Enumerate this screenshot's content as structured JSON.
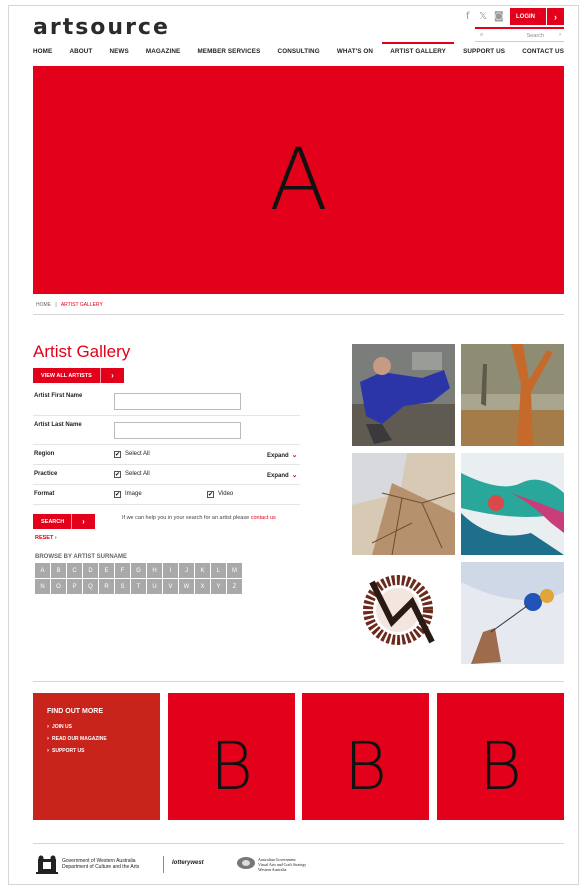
{
  "site": {
    "logo": "artsource"
  },
  "header": {
    "social": {
      "facebook": "f",
      "twitter": "𝕏",
      "instagram": "◙"
    },
    "login_label": "LOGIN",
    "search_placeholder": "Search"
  },
  "nav": [
    "HOME",
    "ABOUT",
    "NEWS",
    "MAGAZINE",
    "MEMBER SERVICES",
    "CONSULTING",
    "WHAT'S ON",
    "ARTIST GALLERY",
    "SUPPORT US",
    "CONTACT US"
  ],
  "hero": {
    "letter": "A"
  },
  "breadcrumb": {
    "home": "HOME",
    "separator": "|",
    "current": "ARTIST GALLERY"
  },
  "gallery": {
    "title": "Artist Gallery",
    "view_all_label": "VIEW ALL ARTISTS",
    "first_name_label": "Artist First Name",
    "first_name_value": "",
    "last_name_label": "Artist Last Name",
    "last_name_value": "",
    "region_label": "Region",
    "practice_label": "Practice",
    "format_label": "Format",
    "select_all": "Select All",
    "expand": "Expand",
    "image_label": "Image",
    "video_label": "Video",
    "search_label": "SEARCH",
    "help_text": "If we can help you in your search for an artist please",
    "help_link": "contact us",
    "reset_label": "RESET",
    "browse_label": "BROWSE BY ARTIST SURNAME",
    "letters": [
      "A",
      "B",
      "C",
      "D",
      "E",
      "F",
      "G",
      "H",
      "I",
      "J",
      "K",
      "L",
      "M",
      "N",
      "O",
      "P",
      "Q",
      "R",
      "S",
      "T",
      "U",
      "V",
      "W",
      "X",
      "Y",
      "Z"
    ]
  },
  "find_out_more": {
    "heading": "FIND OUT MORE",
    "links": [
      "JOIN US",
      "READ OUR MAGAZINE",
      "SUPPORT US"
    ]
  },
  "promo_letters": [
    "B",
    "B",
    "B"
  ],
  "footer": {
    "wa_line1": "Government of Western Australia",
    "wa_line2": "Department of Culture and the Arts",
    "lotterywest": "lotterywest",
    "aus_line1": "Australian Government",
    "aus_line2": "Visual Arts and Craft Strategy",
    "aus_line3": "Western Australia"
  },
  "colors": {
    "brand_red": "#e2001a",
    "panel_red": "#c9241c",
    "letter_grey": "#a9a9a9"
  }
}
